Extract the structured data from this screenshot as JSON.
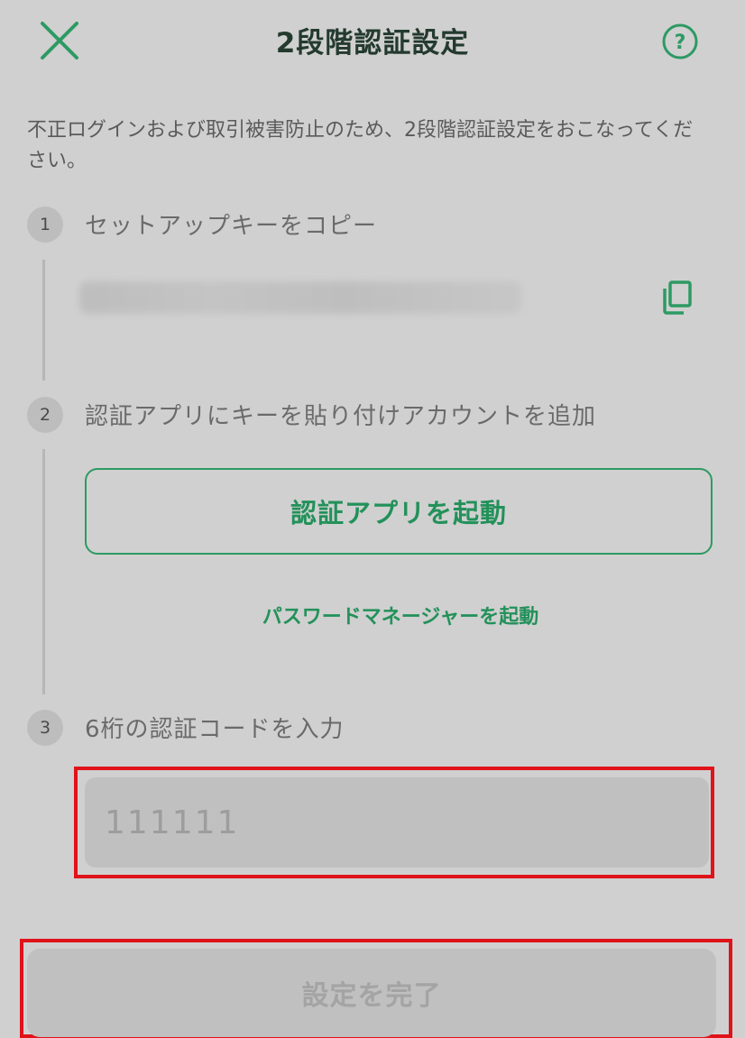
{
  "header": {
    "title": "2段階認証設定",
    "close_icon": "close-icon",
    "help_icon": "help-icon"
  },
  "intro": "不正ログインおよび取引被害防止のため、2段階認証設定をおこなってください。",
  "steps": [
    {
      "number": "1",
      "label": "セットアップキーをコピー"
    },
    {
      "number": "2",
      "label": "認証アプリにキーを貼り付けアカウントを追加"
    },
    {
      "number": "3",
      "label": "6桁の認証コードを入力"
    }
  ],
  "launch_app_button": "認証アプリを起動",
  "password_manager_link": "パスワードマネージャーを起動",
  "code_input": {
    "placeholder": "111111",
    "value": ""
  },
  "complete_button": "設定を完了",
  "colors": {
    "accent": "#23915a",
    "highlight": "#e0121a",
    "background": "#d0d0d0"
  }
}
